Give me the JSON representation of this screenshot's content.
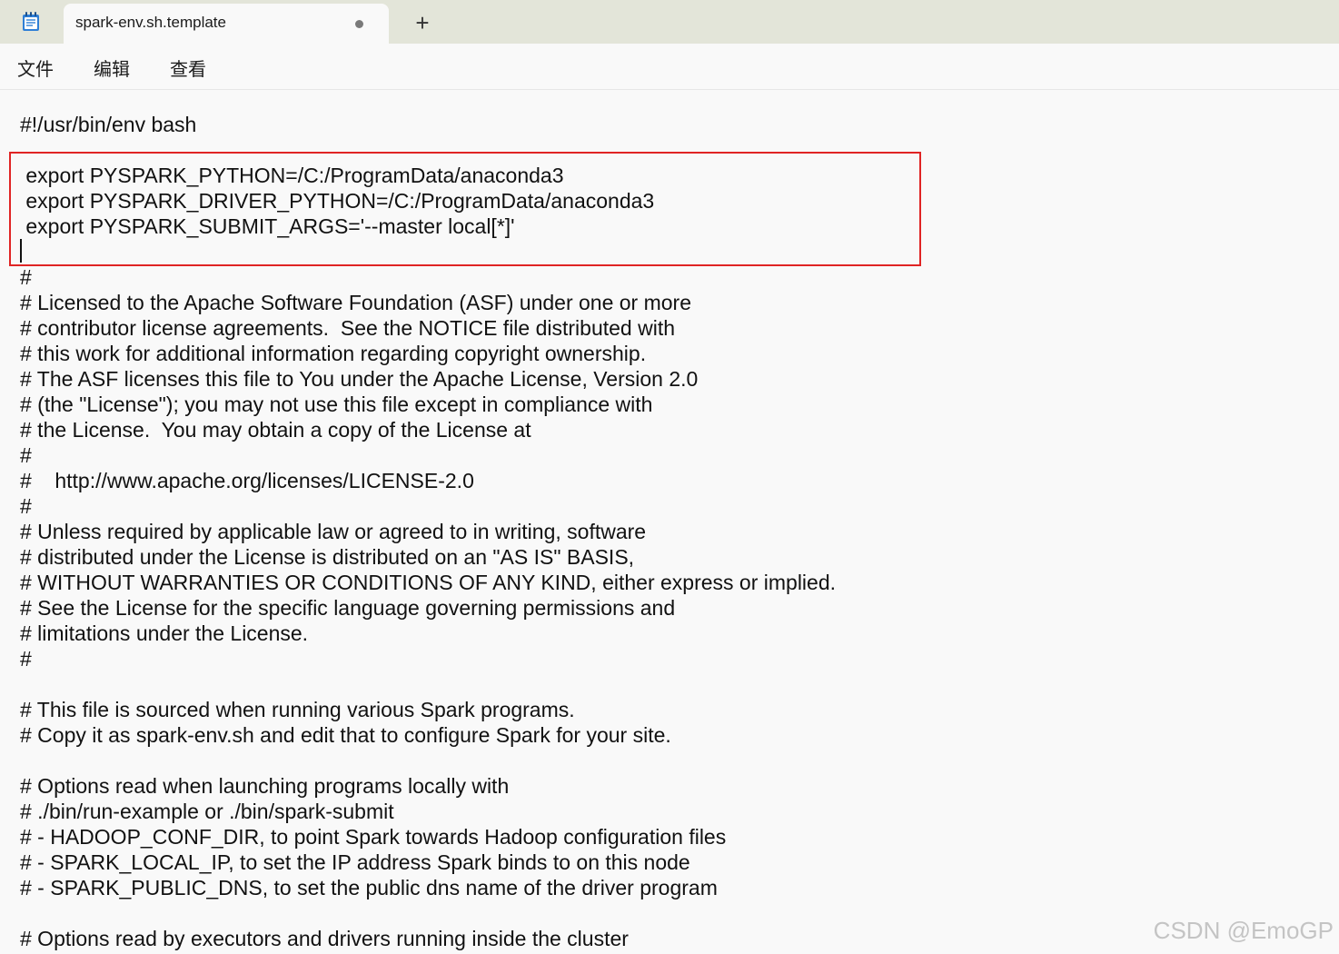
{
  "tab": {
    "title": "spark-env.sh.template",
    "new_tab_label": "+"
  },
  "menu": [
    "文件",
    "编辑",
    "查看"
  ],
  "editor": {
    "lines": [
      "#!/usr/bin/env bash",
      "",
      " export PYSPARK_PYTHON=/C:/ProgramData/anaconda3",
      " export PYSPARK_DRIVER_PYTHON=/C:/ProgramData/anaconda3",
      " export PYSPARK_SUBMIT_ARGS='--master local[*]'",
      "",
      "#",
      "# Licensed to the Apache Software Foundation (ASF) under one or more",
      "# contributor license agreements.  See the NOTICE file distributed with",
      "# this work for additional information regarding copyright ownership.",
      "# The ASF licenses this file to You under the Apache License, Version 2.0",
      "# (the \"License\"); you may not use this file except in compliance with",
      "# the License.  You may obtain a copy of the License at",
      "#",
      "#    http://www.apache.org/licenses/LICENSE-2.0",
      "#",
      "# Unless required by applicable law or agreed to in writing, software",
      "# distributed under the License is distributed on an \"AS IS\" BASIS,",
      "# WITHOUT WARRANTIES OR CONDITIONS OF ANY KIND, either express or implied.",
      "# See the License for the specific language governing permissions and",
      "# limitations under the License.",
      "#",
      "",
      "# This file is sourced when running various Spark programs.",
      "# Copy it as spark-env.sh and edit that to configure Spark for your site.",
      "",
      "# Options read when launching programs locally with",
      "# ./bin/run-example or ./bin/spark-submit",
      "# - HADOOP_CONF_DIR, to point Spark towards Hadoop configuration files",
      "# - SPARK_LOCAL_IP, to set the IP address Spark binds to on this node",
      "# - SPARK_PUBLIC_DNS, to set the public dns name of the driver program",
      "",
      "# Options read by executors and drivers running inside the cluster"
    ]
  },
  "watermark": "CSDN @EmoGP",
  "colors": {
    "titlebar": "#e3e5d9",
    "editor_bg": "#f9f9f9",
    "highlight": "#e02424"
  }
}
